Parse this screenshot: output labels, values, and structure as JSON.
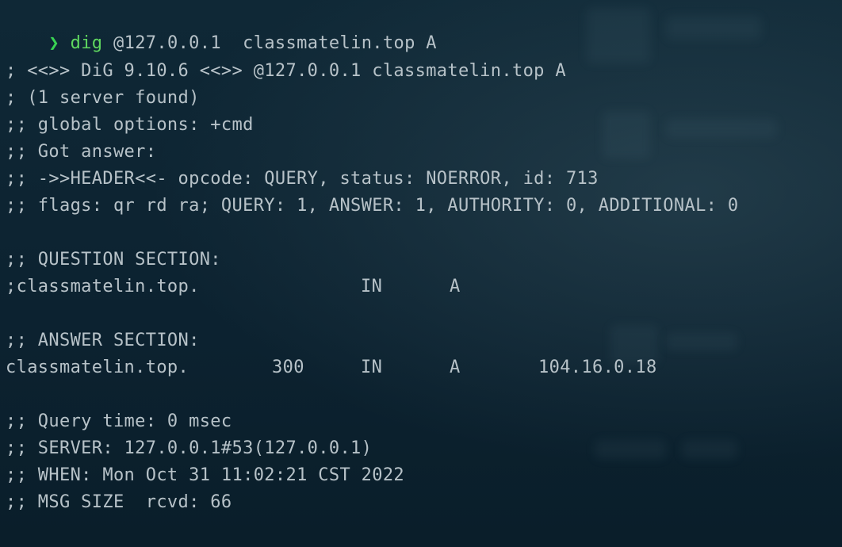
{
  "prompt": {
    "arrow": "❯",
    "command": "dig",
    "args": " @127.0.0.1  classmatelin.top A"
  },
  "header": {
    "version_line": "; <<>> DiG 9.10.6 <<>> @127.0.0.1 classmatelin.top A",
    "servers_found": "; (1 server found)",
    "global_options": ";; global options: +cmd",
    "got_answer": ";; Got answer:",
    "header_line": ";; ->>HEADER<<- opcode: QUERY, status: NOERROR, id: 713",
    "flags_line": ";; flags: qr rd ra; QUERY: 1, ANSWER: 1, AUTHORITY: 0, ADDITIONAL: 0"
  },
  "question": {
    "title": ";; QUESTION SECTION:",
    "name": ";classmatelin.top.",
    "class": "IN",
    "type": "A"
  },
  "answer": {
    "title": ";; ANSWER SECTION:",
    "name": "classmatelin.top.",
    "ttl": "300",
    "class": "IN",
    "type": "A",
    "address": "104.16.0.18"
  },
  "footer": {
    "query_time": ";; Query time: 0 msec",
    "server": ";; SERVER: 127.0.0.1#53(127.0.0.1)",
    "when": ";; WHEN: Mon Oct 31 11:02:21 CST 2022",
    "msg_size": ";; MSG SIZE  rcvd: 66"
  }
}
